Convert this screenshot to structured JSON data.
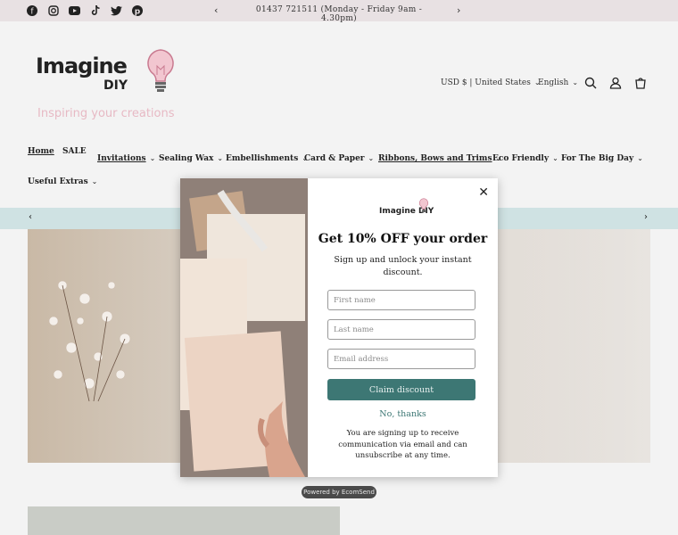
{
  "announcement": {
    "text": "01437 721511 (Monday - Friday 9am - 4.30pm)",
    "social_icons": [
      "facebook-icon",
      "instagram-icon",
      "youtube-icon",
      "tiktok-icon",
      "twitter-icon",
      "pinterest-icon"
    ]
  },
  "header": {
    "logo_text": "Imagine",
    "logo_sub": "DIY",
    "tagline": "Inspiring your creations",
    "currency": "USD $ | United States",
    "language": "English"
  },
  "nav": {
    "items": [
      {
        "label": "Home",
        "underlined": true,
        "dropdown": false
      },
      {
        "label": "SALE",
        "underlined": false,
        "dropdown": false
      },
      {
        "label": "Invitations",
        "underlined": true,
        "dropdown": true
      },
      {
        "label": "Sealing Wax",
        "underlined": false,
        "dropdown": true
      },
      {
        "label": "Embellishments",
        "underlined": false,
        "dropdown": true
      },
      {
        "label": "Card & Paper",
        "underlined": false,
        "dropdown": true
      },
      {
        "label": "Ribbons, Bows and Trims",
        "underlined": true,
        "dropdown": true
      },
      {
        "label": "Eco Friendly",
        "underlined": false,
        "dropdown": true
      },
      {
        "label": "For The Big Day",
        "underlined": false,
        "dropdown": true
      },
      {
        "label": "Useful Extras",
        "underlined": false,
        "dropdown": true
      }
    ]
  },
  "popup": {
    "logo_text": "Imagine DIY",
    "title": "Get 10% OFF your order",
    "subtitle": "Sign up and unlock your instant discount.",
    "first_name_placeholder": "First name",
    "last_name_placeholder": "Last name",
    "email_placeholder": "Email address",
    "claim_label": "Claim discount",
    "no_thanks_label": "No, thanks",
    "legal": "You are signing up to receive communication via email and can unsubscribe at any time.",
    "powered_by": "Powered by EcomSend"
  },
  "colors": {
    "topbar": "#e8e1e3",
    "accent": "#3d7774",
    "tagline": "#e7b9c4",
    "strip": "#cfe2e3"
  }
}
